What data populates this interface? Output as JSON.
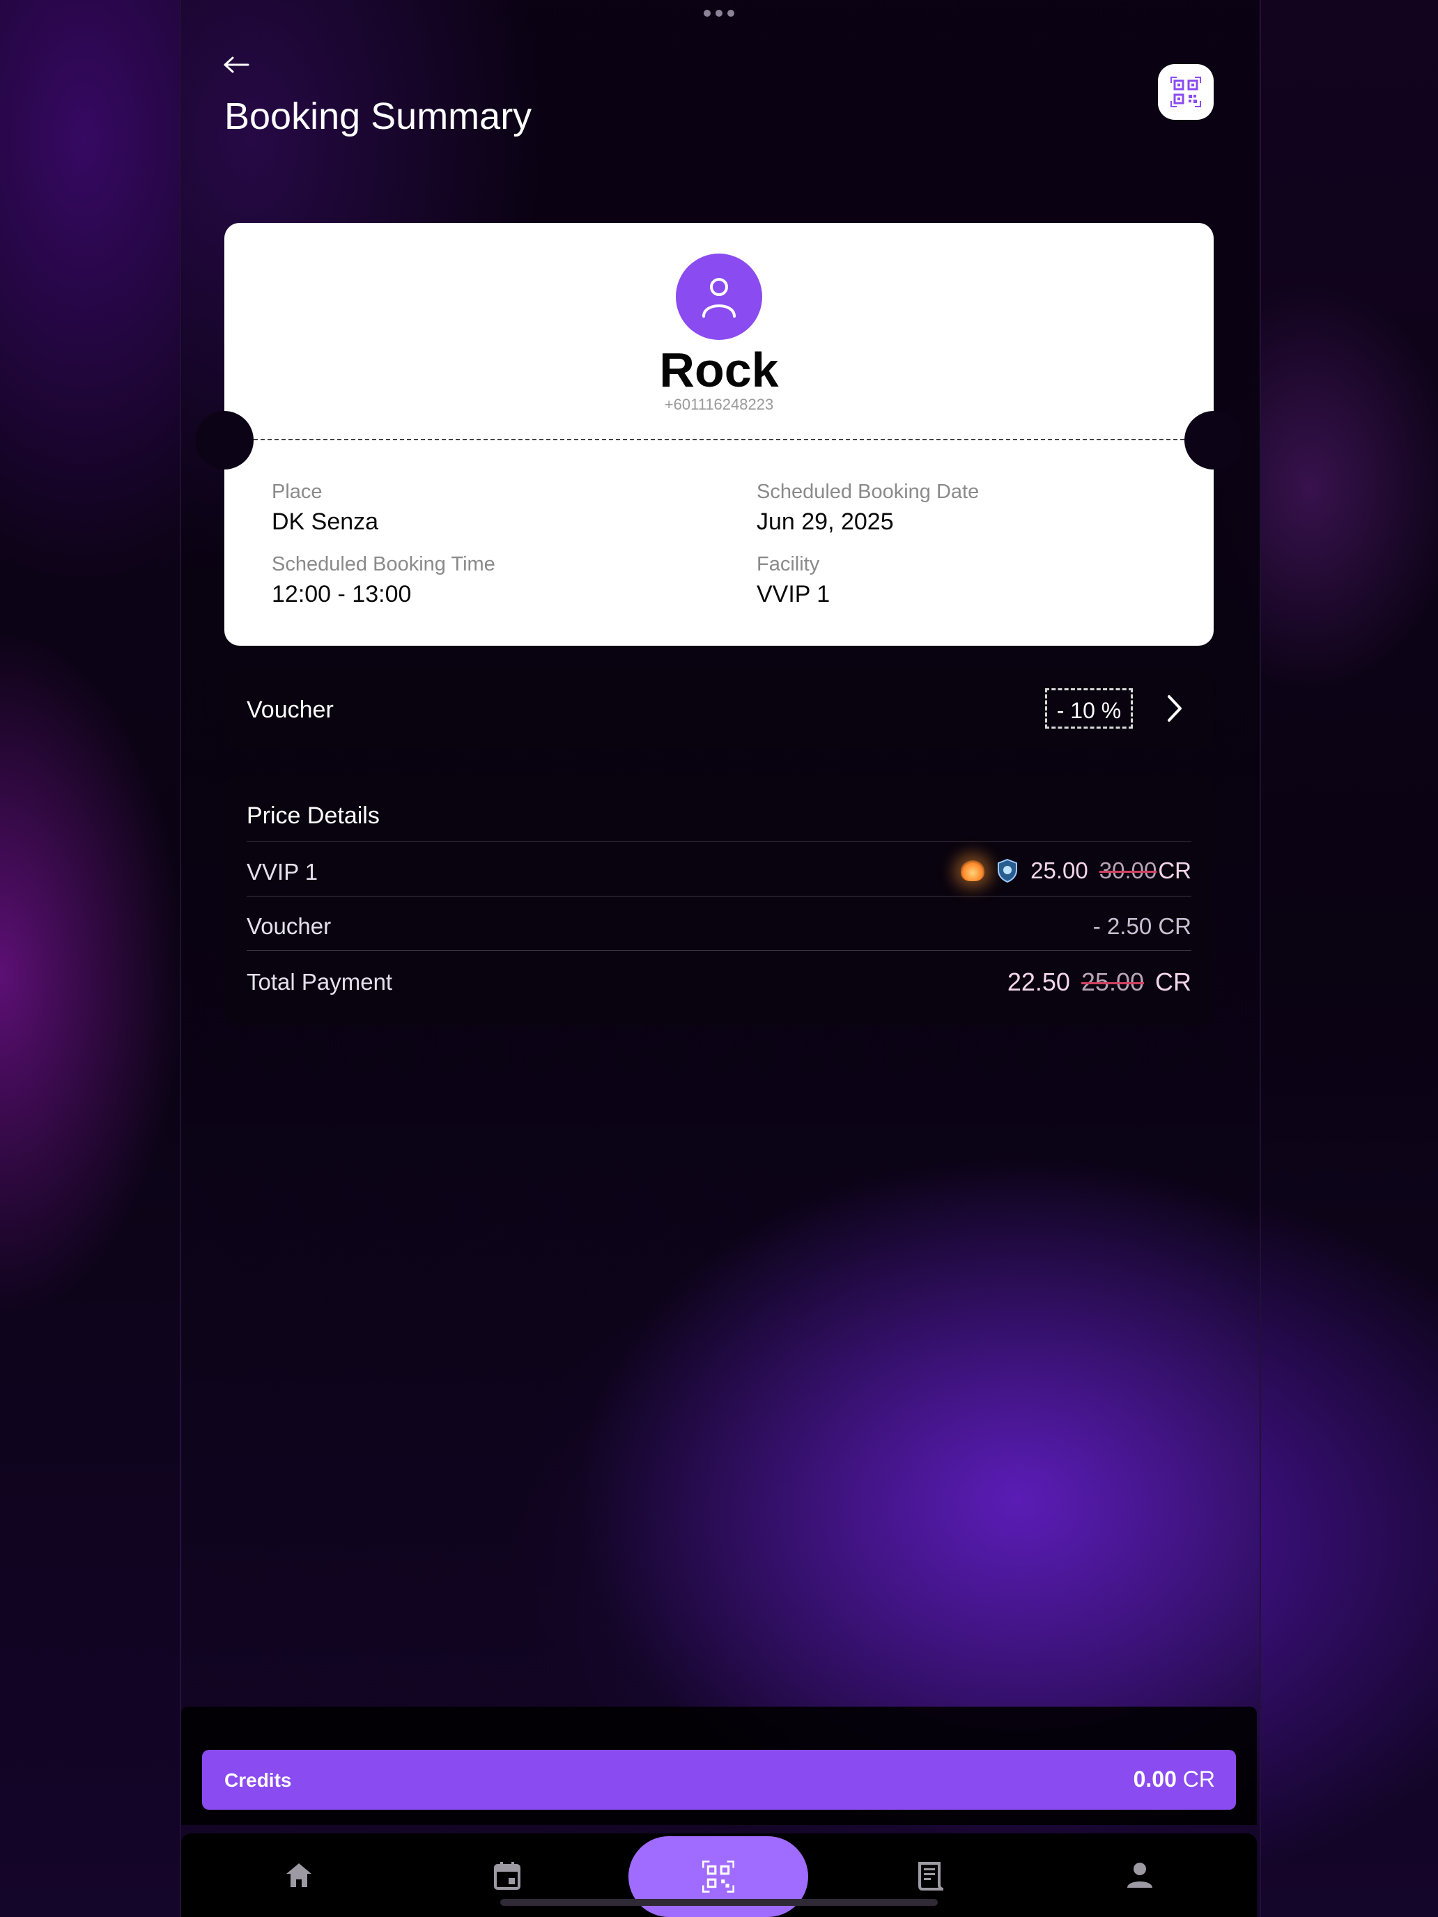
{
  "header": {
    "back_icon": "arrow-left-icon",
    "title": "Booking Summary",
    "qr_icon": "qr-code-icon"
  },
  "ticket": {
    "avatar_icon": "person-icon",
    "name": "Rock",
    "phone": "+601116248223",
    "fields": {
      "place_label": "Place",
      "place_value": "DK Senza",
      "date_label": "Scheduled Booking Date",
      "date_value": "Jun 29, 2025",
      "time_label": "Scheduled Booking Time",
      "time_value": "12:00 - 13:00",
      "facility_label": "Facility",
      "facility_value": "VVIP 1"
    }
  },
  "voucher": {
    "label": "Voucher",
    "badge": "- 10 %",
    "chevron_icon": "chevron-right-icon"
  },
  "price": {
    "title": "Price Details",
    "rows": [
      {
        "label": "VVIP 1",
        "value": "25.00",
        "old": "30.00",
        "unit": "CR",
        "icons": [
          "fire-icon",
          "shield-icon"
        ]
      },
      {
        "label": "Voucher",
        "value": "- 2.50 CR"
      },
      {
        "label": "Total Payment",
        "value": "22.50",
        "old": "25.00",
        "unit": "CR"
      }
    ]
  },
  "credits": {
    "label": "Credits",
    "amount": "0.00",
    "unit": "CR"
  },
  "nav": [
    "home-icon",
    "calendar-icon",
    "qr-scan-icon",
    "receipt-icon",
    "profile-icon"
  ],
  "colors": {
    "accent": "#8a4bf0",
    "nav_center": "#a06bff",
    "background": "#0a0310"
  }
}
